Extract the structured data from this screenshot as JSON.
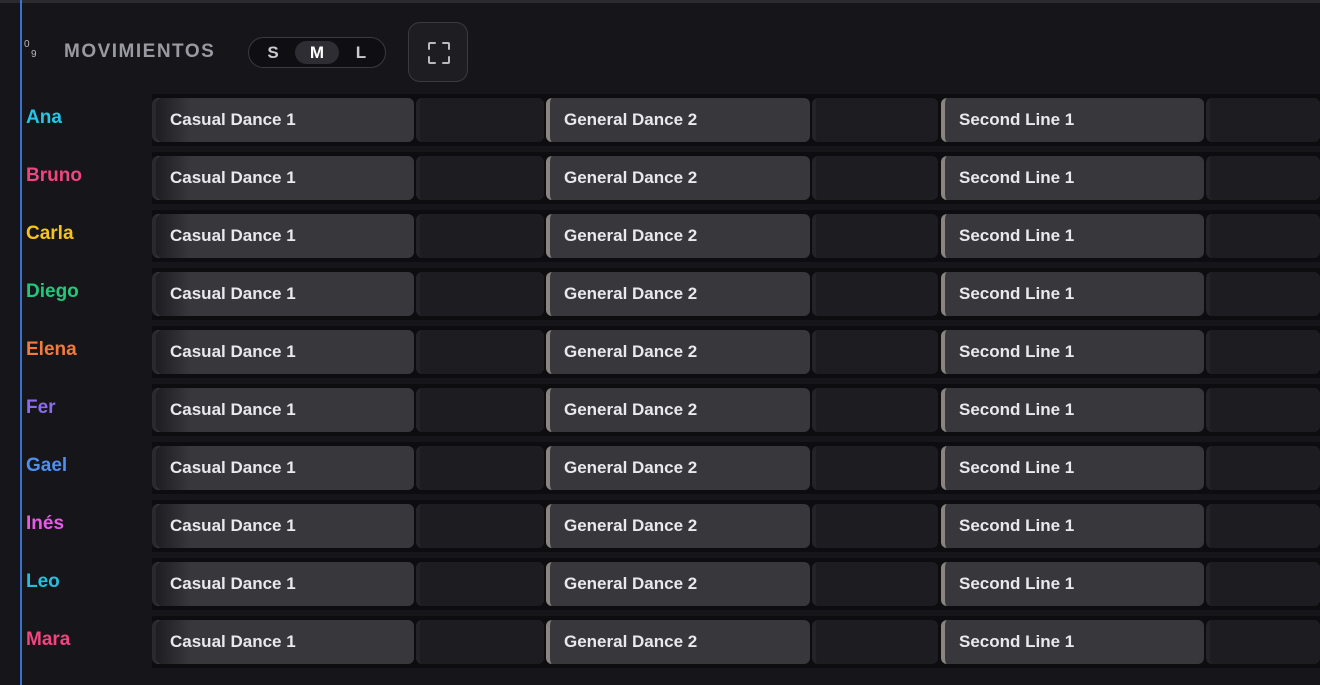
{
  "header": {
    "title": "MOVIMIENTOS",
    "sort_icon_top": "0",
    "sort_icon_bottom": "9",
    "size_options": [
      "S",
      "M",
      "L"
    ],
    "selected_size": "M",
    "fullscreen_icon": "fullscreen-icon"
  },
  "rows": [
    {
      "name": "Ana",
      "color": "#22c7e8",
      "blocks": [
        "Casual Dance 1",
        "General Dance 2",
        "Second Line 1"
      ]
    },
    {
      "name": "Bruno",
      "color": "#f0457e",
      "blocks": [
        "Casual Dance 1",
        "General Dance 2",
        "Second Line 1"
      ]
    },
    {
      "name": "Carla",
      "color": "#f5c518",
      "blocks": [
        "Casual Dance 1",
        "General Dance 2",
        "Second Line 1"
      ]
    },
    {
      "name": "Diego",
      "color": "#22c97a",
      "blocks": [
        "Casual Dance 1",
        "General Dance 2",
        "Second Line 1"
      ]
    },
    {
      "name": "Elena",
      "color": "#f47a3a",
      "blocks": [
        "Casual Dance 1",
        "General Dance 2",
        "Second Line 1"
      ]
    },
    {
      "name": "Fer",
      "color": "#8b6cf0",
      "blocks": [
        "Casual Dance 1",
        "General Dance 2",
        "Second Line 1"
      ]
    },
    {
      "name": "Gael",
      "color": "#4f8ff0",
      "blocks": [
        "Casual Dance 1",
        "General Dance 2",
        "Second Line 1"
      ]
    },
    {
      "name": "Inés",
      "color": "#e85ae8",
      "blocks": [
        "Casual Dance 1",
        "General Dance 2",
        "Second Line 1"
      ]
    },
    {
      "name": "Leo",
      "color": "#22c0dc",
      "blocks": [
        "Casual Dance 1",
        "General Dance 2",
        "Second Line 1"
      ]
    },
    {
      "name": "Mara",
      "color": "#f0457e",
      "blocks": [
        "Casual Dance 1",
        "General Dance 2",
        "Second Line 1"
      ]
    }
  ]
}
